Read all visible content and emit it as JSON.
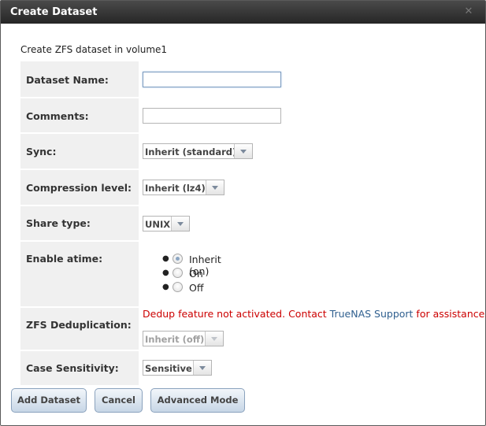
{
  "window": {
    "title": "Create Dataset",
    "close_glyph": "✕"
  },
  "intro": "Create ZFS dataset in volume1",
  "fields": {
    "dataset_name": {
      "label": "Dataset Name:",
      "value": ""
    },
    "comments": {
      "label": "Comments:",
      "value": ""
    },
    "sync": {
      "label": "Sync:",
      "selected": "Inherit (standard)"
    },
    "compression": {
      "label": "Compression level:",
      "selected": "Inherit (lz4)"
    },
    "share_type": {
      "label": "Share type:",
      "selected": "UNIX"
    },
    "atime": {
      "label": "Enable atime:",
      "options": [
        "Inherit (on)",
        "On",
        "Off"
      ],
      "selected": "Inherit (on)"
    },
    "dedup": {
      "label": "ZFS Deduplication:",
      "message_pre": "Dedup feature not activated. Contact ",
      "message_link": "TrueNAS Support",
      "message_post": " for assistance.",
      "selected": "Inherit (off)",
      "disabled": true
    },
    "case_sensitivity": {
      "label": "Case Sensitivity:",
      "selected": "Sensitive"
    }
  },
  "buttons": {
    "add": "Add Dataset",
    "cancel": "Cancel",
    "advanced": "Advanced Mode"
  },
  "colors": {
    "titlebar": "#2e2e2e",
    "label_bg": "#f0f0f0",
    "error": "#cc0000",
    "link": "#2f5f8f",
    "button_border": "#8aa2bd"
  }
}
